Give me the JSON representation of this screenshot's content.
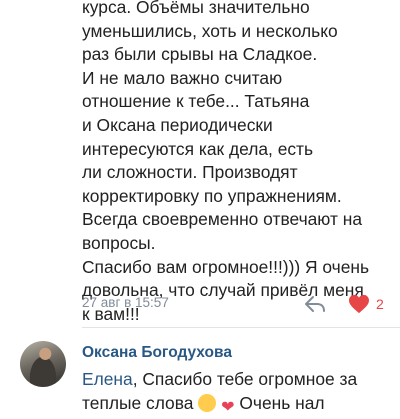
{
  "comment": {
    "lines": [
      "курса. Объёмы значительно",
      "уменьшились, хоть и несколько",
      "раз были срывы на Сладкое.",
      "И не мало важно считаю",
      "отношение к тебе... Татьяна",
      "и Оксана периодически",
      "интересуются как дела, есть",
      "ли сложности. Производят",
      "корректировку по упражнениям.",
      "Всегда своевременно отвечают на",
      "вопросы.",
      "Спасибо вам огромное!!!))) Я очень",
      "довольна, что случай привёл меня",
      "к вам!!!"
    ],
    "timestamp": "27 авг в 15:57",
    "like_count": "2",
    "icons": {
      "reply": "reply-arrow-icon",
      "like": "heart-icon"
    },
    "colors": {
      "like": "#e64646",
      "meta": "#818c99"
    }
  },
  "reply": {
    "author": "Оксана Богодухова",
    "mention": "Елена",
    "line1_rest": ", Спасибо тебе огромное за",
    "line2_start": "теплые слова",
    "line2_end": "Очень нал",
    "colors": {
      "author": "#2a5885"
    }
  }
}
